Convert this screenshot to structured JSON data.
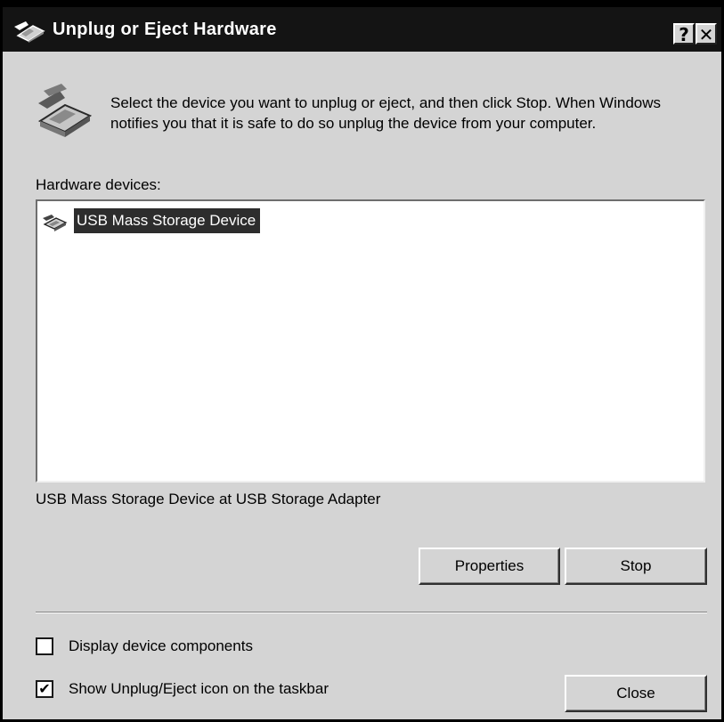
{
  "window": {
    "title": "Unplug or Eject Hardware",
    "help_label": "?",
    "close_label": "✕"
  },
  "instructions": "Select the device you want to unplug or eject, and then click Stop. When Windows notifies you that it is safe to do so unplug the device from your computer.",
  "hardware_devices_label": "Hardware devices:",
  "devices": [
    {
      "label": "USB Mass Storage Device",
      "icon": "usb-device-icon",
      "selected": true
    }
  ],
  "device_description": "USB Mass Storage Device at USB Storage Adapter",
  "buttons": {
    "properties": "Properties",
    "stop": "Stop",
    "close": "Close"
  },
  "options": {
    "display_components": {
      "label": "Display device components",
      "checked": false,
      "mark": ""
    },
    "show_icon": {
      "label": "Show Unplug/Eject icon on the taskbar",
      "checked": true,
      "mark": "✔"
    }
  },
  "colors": {
    "title_bar": "#141414",
    "dialog_face": "#d4d4d4",
    "selection": "#2d2d2d"
  }
}
